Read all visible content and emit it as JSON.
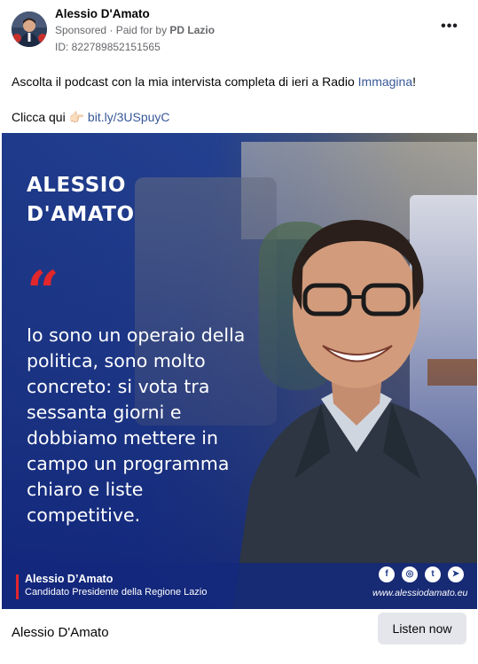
{
  "post": {
    "author": "Alessio D'Amato",
    "sponsored": "Sponsored",
    "separator": " · ",
    "paid_for_prefix": "Paid for by ",
    "paid_for_by": "PD Lazio",
    "ad_id": "ID: 822789852151565",
    "more_icon": "more-horizontal-icon",
    "text_line1_prefix": "Ascolta il podcast con la mia intervista completa di ieri a Radio ",
    "text_line1_link": "Immagina",
    "text_line1_suffix": "!",
    "text_line2_prefix": "Clicca qui ",
    "text_line2_emoji": "👉🏻",
    "text_line2_link": "bit.ly/3USpuyC"
  },
  "ad_image": {
    "name_line1": "ALESSIO",
    "name_line2": "D'AMATO",
    "quote_mark": "“",
    "quote": "Io sono un operaio della politica, sono molto concreto: si vota tra sessanta giorni e dobbiamo mettere in campo un programma chiaro e liste competitive.",
    "signature_name": "Alessio D’Amato",
    "signature_role": "Candidato Presidente della Regione Lazio",
    "social_icons": [
      "facebook-icon",
      "instagram-icon",
      "twitter-icon",
      "telegram-icon"
    ],
    "website": "www.alessiodamato.eu",
    "accent_color": "#e1262c",
    "brand_color": "#1f3a8a"
  },
  "cta": {
    "page_name": "Alessio D'Amato",
    "button_label": "Listen now"
  }
}
